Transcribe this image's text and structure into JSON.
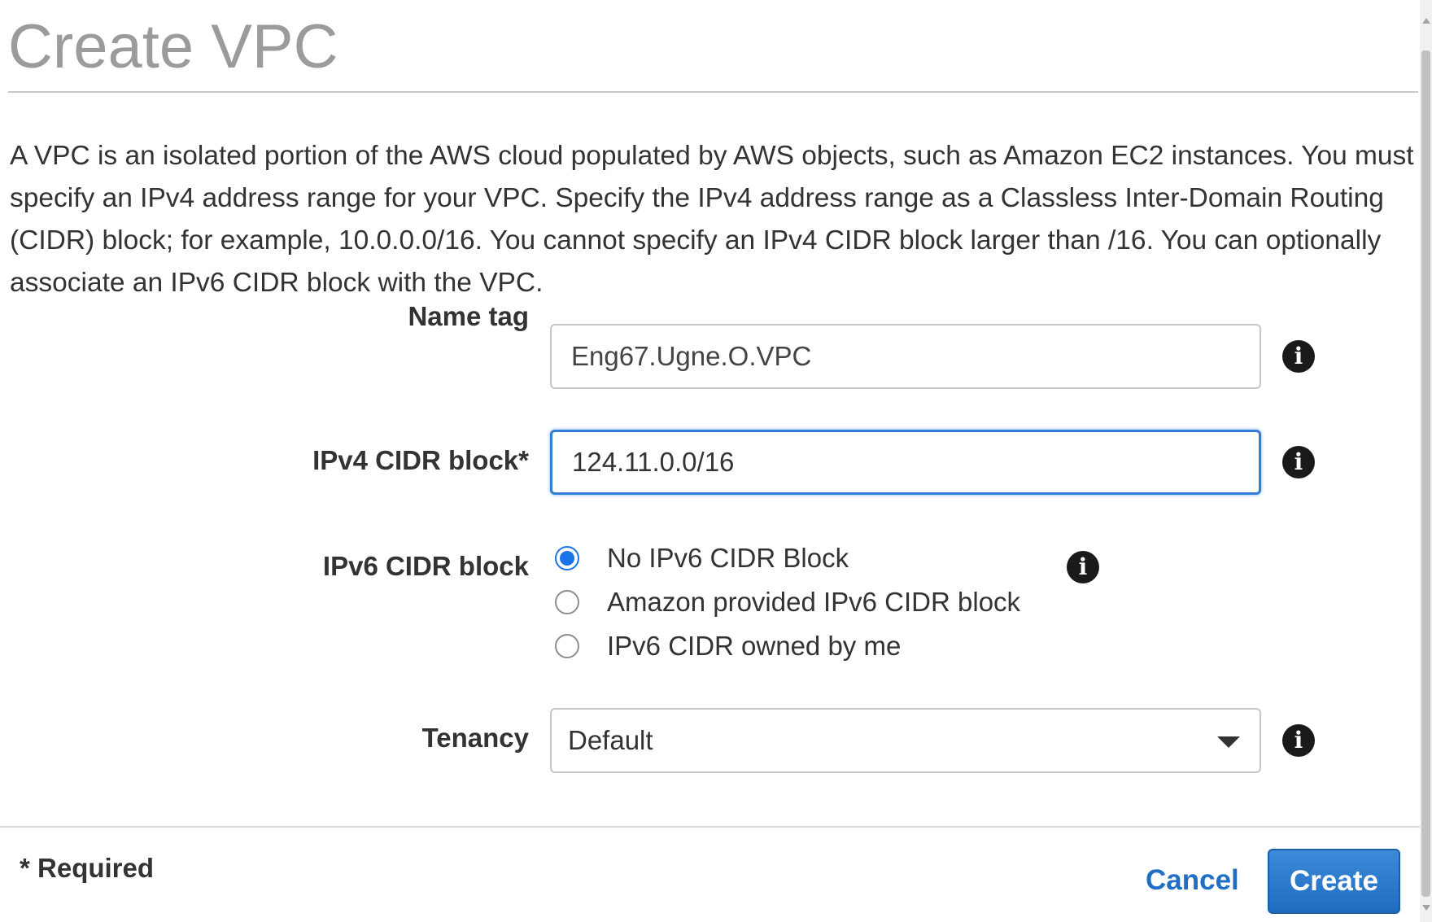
{
  "dialog": {
    "title": "Create VPC",
    "description": "A VPC is an isolated portion of the AWS cloud populated by AWS objects, such as Amazon EC2 instances. You must specify an IPv4 address range for your VPC. Specify the IPv4 address range as a Classless Inter-Domain Routing (CIDR) block; for example, 10.0.0.0/16. You cannot specify an IPv4 CIDR block larger than /16. You can optionally associate an IPv6 CIDR block with the VPC."
  },
  "form": {
    "name_tag": {
      "label": "Name tag",
      "value": "Eng67.Ugne.O.VPC",
      "info_icon": "info-icon"
    },
    "ipv4_cidr": {
      "label": "IPv4 CIDR block*",
      "value": "124.11.0.0/16",
      "info_icon": "info-icon",
      "focused": true
    },
    "ipv6_cidr": {
      "label": "IPv6 CIDR block",
      "options": [
        {
          "label": "No IPv6 CIDR Block",
          "checked": true
        },
        {
          "label": "Amazon provided IPv6 CIDR block",
          "checked": false
        },
        {
          "label": "IPv6 CIDR owned by me",
          "checked": false
        }
      ],
      "info_icon": "info-icon"
    },
    "tenancy": {
      "label": "Tenancy",
      "selected": "Default",
      "info_icon": "info-icon"
    }
  },
  "footer": {
    "required_note": "* Required",
    "cancel_label": "Cancel",
    "create_label": "Create"
  },
  "colors": {
    "accent": "#1f6fc4",
    "focus_border": "#2f7fd8",
    "title_gray": "#9b9b9b"
  }
}
